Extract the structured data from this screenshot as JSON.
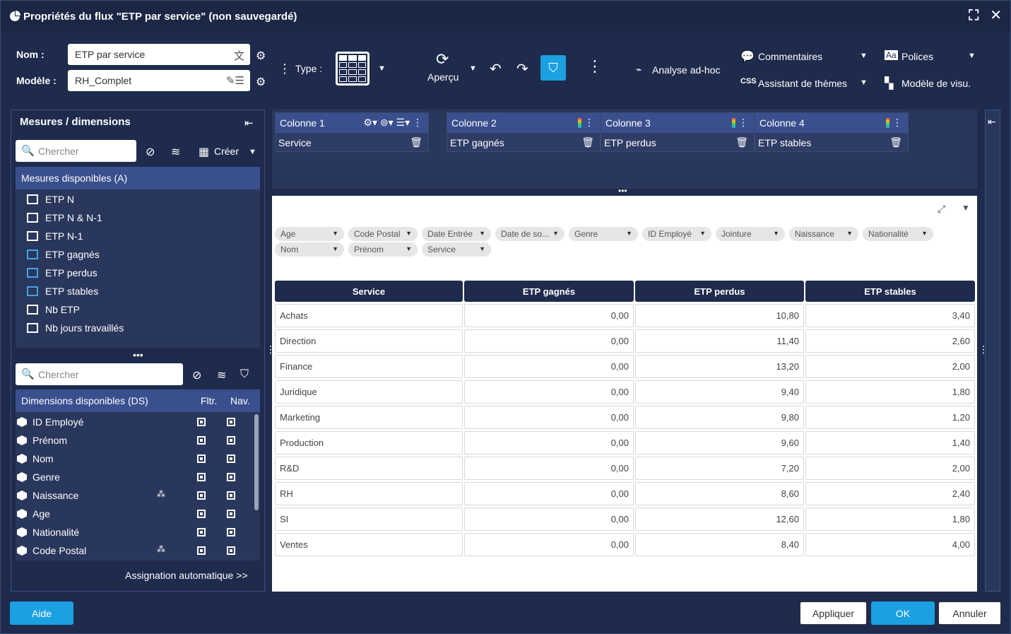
{
  "window": {
    "title": "Propriétés du flux \"ETP par service\" (non sauvegardé)"
  },
  "form": {
    "nom_label": "Nom :",
    "nom_value": "ETP par service",
    "modele_label": "Modèle :",
    "modele_value": "RH_Complet"
  },
  "toolbar": {
    "type_label": "Type :",
    "apercu_label": "Aperçu",
    "analyse_label": "Analyse ad-hoc",
    "commentaires_label": "Commentaires",
    "assistant_label": "Assistant de thèmes",
    "polices_label": "Polices",
    "modele_visu_label": "Modèle de visu."
  },
  "left_panel": {
    "title": "Mesures / dimensions",
    "search_placeholder": "Chercher",
    "creer_label": "Créer",
    "mesures_header": "Mesures disponibles (A)",
    "mesures": [
      {
        "label": "ETP N",
        "used": false
      },
      {
        "label": "ETP N & N-1",
        "used": false
      },
      {
        "label": "ETP N-1",
        "used": false
      },
      {
        "label": "ETP gagnés",
        "used": true
      },
      {
        "label": "ETP perdus",
        "used": true
      },
      {
        "label": "ETP stables",
        "used": true
      },
      {
        "label": "Nb ETP",
        "used": false
      },
      {
        "label": "Nb jours travaillés",
        "used": false
      }
    ],
    "search2_placeholder": "Chercher",
    "dim_header": "Dimensions disponibles (DS)",
    "dim_col_fltr": "Fltr.",
    "dim_col_nav": "Nav.",
    "dimensions": [
      {
        "label": "ID Employé",
        "hier": false
      },
      {
        "label": "Prénom",
        "hier": false
      },
      {
        "label": "Nom",
        "hier": false
      },
      {
        "label": "Genre",
        "hier": false
      },
      {
        "label": "Naissance",
        "hier": true
      },
      {
        "label": "Age",
        "hier": false
      },
      {
        "label": "Nationalité",
        "hier": false
      },
      {
        "label": "Code Postal",
        "hier": true
      }
    ],
    "auto_assign": "Assignation automatique >>"
  },
  "columns": [
    {
      "header": "Colonne 1",
      "value": "Service"
    },
    {
      "header": "Colonne 2",
      "value": "ETP gagnés"
    },
    {
      "header": "Colonne 3",
      "value": "ETP perdus"
    },
    {
      "header": "Colonne 4",
      "value": "ETP stables"
    }
  ],
  "filters": [
    "Age",
    "Code Postal",
    "Date Entrée",
    "Date de so...",
    "Genre",
    "ID Employé",
    "Jointure",
    "Naissance",
    "Nationalité",
    "Nom",
    "Prénom",
    "Service"
  ],
  "table": {
    "headers": [
      "Service",
      "ETP gagnés",
      "ETP perdus",
      "ETP stables"
    ],
    "rows": [
      [
        "Achats",
        "0,00",
        "10,80",
        "3,40"
      ],
      [
        "Direction",
        "0,00",
        "11,40",
        "2,60"
      ],
      [
        "Finance",
        "0,00",
        "13,20",
        "2,00"
      ],
      [
        "Juridique",
        "0,00",
        "9,40",
        "1,80"
      ],
      [
        "Marketing",
        "0,00",
        "9,80",
        "1,20"
      ],
      [
        "Production",
        "0,00",
        "9,60",
        "1,40"
      ],
      [
        "R&D",
        "0,00",
        "7,20",
        "2,00"
      ],
      [
        "RH",
        "0,00",
        "8,60",
        "2,40"
      ],
      [
        "SI",
        "0,00",
        "12,60",
        "1,80"
      ],
      [
        "Ventes",
        "0,00",
        "8,40",
        "4,00"
      ]
    ]
  },
  "footer": {
    "aide": "Aide",
    "appliquer": "Appliquer",
    "ok": "OK",
    "annuler": "Annuler"
  },
  "colors": {
    "accent": "#1ba1e2",
    "band": "#3a4f8e",
    "background": "#1f2b4d"
  }
}
